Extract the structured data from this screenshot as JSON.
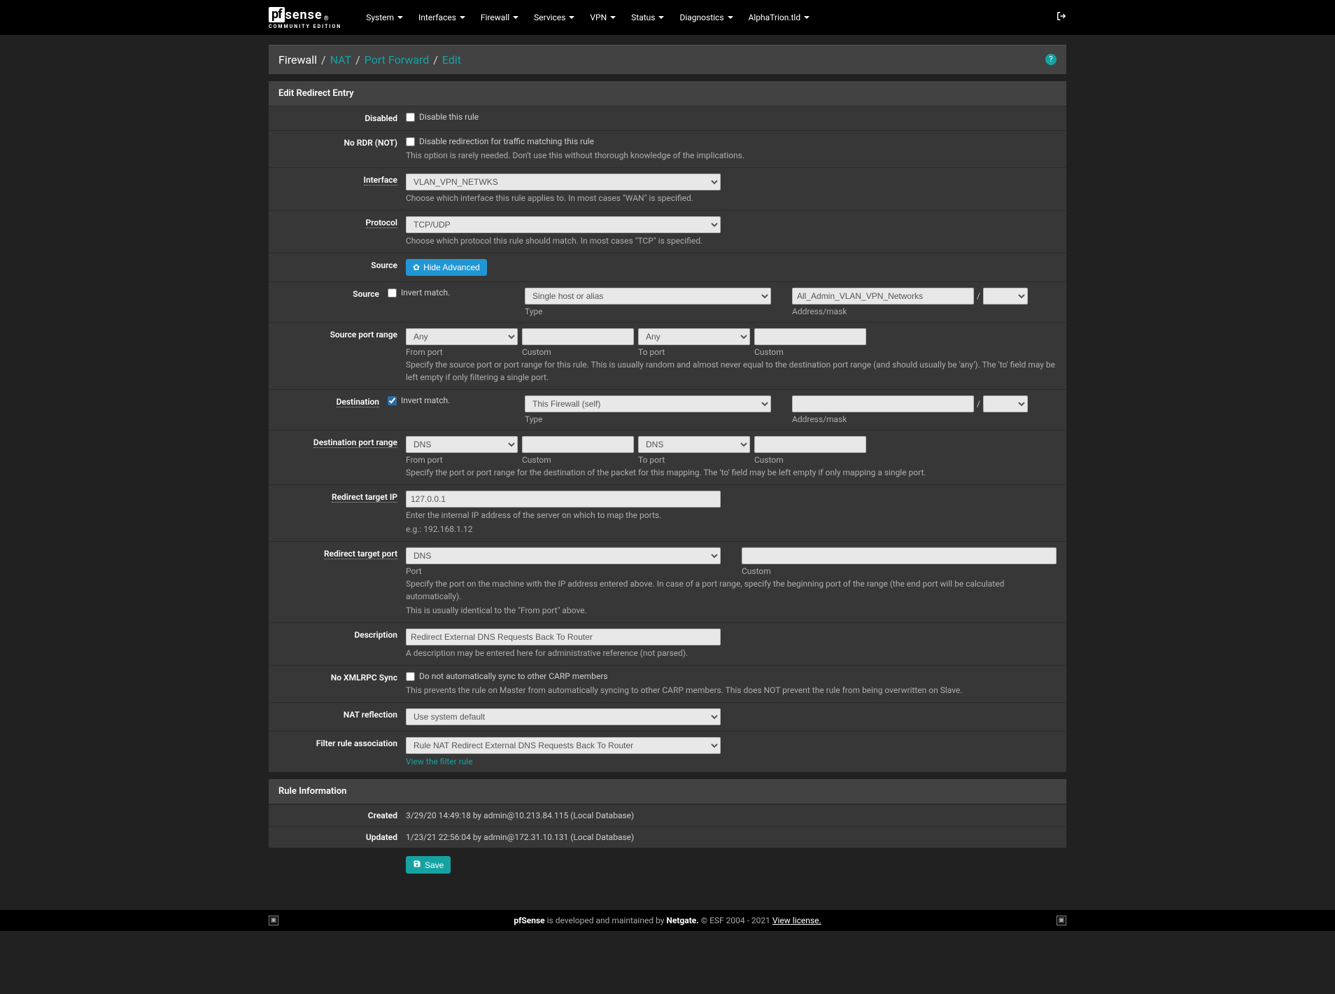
{
  "brand": {
    "pf": "pf",
    "sense": "sense",
    "sub": "COMMUNITY EDITION"
  },
  "nav": [
    "System",
    "Interfaces",
    "Firewall",
    "Services",
    "VPN",
    "Status",
    "Diagnostics",
    "AlphaTrion.tld"
  ],
  "breadcrumb": {
    "first": "Firewall",
    "links": [
      "NAT",
      "Port Forward",
      "Edit"
    ]
  },
  "panel1_title": "Edit Redirect Entry",
  "labels": {
    "disabled": "Disabled",
    "nordr": "No RDR (NOT)",
    "interface": "Interface",
    "protocol": "Protocol",
    "source": "Source",
    "src_port_range": "Source port range",
    "destination": "Destination",
    "dest_port_range": "Destination port range",
    "redirect_ip": "Redirect target IP",
    "redirect_port": "Redirect target port",
    "description": "Description",
    "no_xml": "No XMLRPC Sync",
    "nat_refl": "NAT reflection",
    "filter_assoc": "Filter rule association",
    "created": "Created",
    "updated": "Updated"
  },
  "sublabels": {
    "type": "Type",
    "addr_mask": "Address/mask",
    "from_port": "From port",
    "custom": "Custom",
    "to_port": "To port",
    "port": "Port",
    "invert": "Invert match."
  },
  "chk": {
    "disable": "Disable this rule",
    "nordr": "Disable redirection for traffic matching this rule",
    "noxml": "Do not automatically sync to other CARP members"
  },
  "help": {
    "nordr": "This option is rarely needed. Don't use this without thorough knowledge of the implications.",
    "interface": "Choose which interface this rule applies to. In most cases \"WAN\" is specified.",
    "protocol": "Choose which protocol this rule should match. In most cases \"TCP\" is specified.",
    "src_range": "Specify the source port or port range for this rule. This is usually random and almost never equal to the destination port range (and should usually be 'any'). The 'to' field may be left empty if only filtering a single port.",
    "dest_range": "Specify the port or port range for the destination of the packet for this mapping. The 'to' field may be left empty if only mapping a single port.",
    "redir_ip1": "Enter the internal IP address of the server on which to map the ports.",
    "redir_ip2": "e.g.: 192.168.1.12",
    "redir_port1": "Specify the port on the machine with the IP address entered above. In case of a port range, specify the beginning port of the range (the end port will be calculated automatically).",
    "redir_port2": "This is usually identical to the \"From port\" above.",
    "desc": "A description may be entered here for administrative reference (not parsed).",
    "noxml": "This prevents the rule on Master from automatically syncing to other CARP members. This does NOT prevent the rule from being overwritten on Slave."
  },
  "btn": {
    "hide_adv": "Hide Advanced",
    "save": "Save"
  },
  "values": {
    "interface": "VLAN_VPN_NETWKS",
    "protocol": "TCP/UDP",
    "src_type": "Single host or alias",
    "src_addr": "All_Admin_VLAN_VPN_Networks",
    "src_from": "Any",
    "src_to": "Any",
    "dest_type": "This Firewall (self)",
    "dest_from": "DNS",
    "dest_to": "DNS",
    "redir_ip": "127.0.0.1",
    "redir_port": "DNS",
    "desc": "Redirect External DNS Requests Back To Router",
    "nat_refl": "Use system default",
    "filter_assoc": "Rule NAT Redirect External DNS Requests Back To Router",
    "slash": "/"
  },
  "links": {
    "view_filter": "View the filter rule"
  },
  "panel2_title": "Rule Information",
  "info": {
    "created": "3/29/20 14:49:18 by admin@10.213.84.115 (Local Database)",
    "updated": "1/23/21 22:56:04 by admin@172.31.10.131 (Local Database)"
  },
  "footer": {
    "p1": "pfSense",
    "p2": " is developed and maintained by ",
    "p3": "Netgate.",
    "p4": " © ESF 2004 - 2021 ",
    "link": "View license."
  }
}
